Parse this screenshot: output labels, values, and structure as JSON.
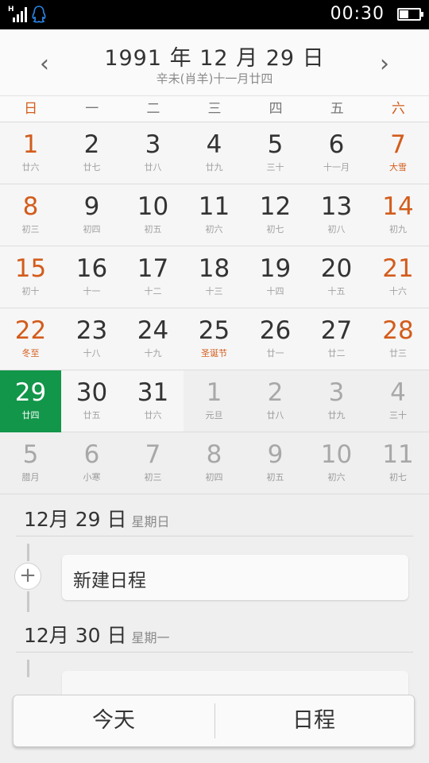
{
  "status_bar": {
    "signal_label": "H",
    "time": "00:30",
    "battery_level": 0.45
  },
  "header": {
    "title": "1991 年 12 月 29 日",
    "lunar_subtitle": "辛未(肖羊)十一月廿四",
    "prev_icon": "chevron-left-icon",
    "next_icon": "chevron-right-icon",
    "prev_glyph": "‹",
    "next_glyph": "›"
  },
  "weekdays": [
    "日",
    "一",
    "二",
    "三",
    "四",
    "五",
    "六"
  ],
  "accent_color": "#d35c1c",
  "selected_color": "#12964a",
  "calendar": {
    "weeks": [
      [
        {
          "day": "1",
          "lunar": "廿六"
        },
        {
          "day": "2",
          "lunar": "廿七"
        },
        {
          "day": "3",
          "lunar": "廿八"
        },
        {
          "day": "4",
          "lunar": "廿九"
        },
        {
          "day": "5",
          "lunar": "三十"
        },
        {
          "day": "6",
          "lunar": "十一月"
        },
        {
          "day": "7",
          "lunar": "大雪",
          "festival": true
        }
      ],
      [
        {
          "day": "8",
          "lunar": "初三"
        },
        {
          "day": "9",
          "lunar": "初四"
        },
        {
          "day": "10",
          "lunar": "初五"
        },
        {
          "day": "11",
          "lunar": "初六"
        },
        {
          "day": "12",
          "lunar": "初七"
        },
        {
          "day": "13",
          "lunar": "初八"
        },
        {
          "day": "14",
          "lunar": "初九"
        }
      ],
      [
        {
          "day": "15",
          "lunar": "初十"
        },
        {
          "day": "16",
          "lunar": "十一"
        },
        {
          "day": "17",
          "lunar": "十二"
        },
        {
          "day": "18",
          "lunar": "十三"
        },
        {
          "day": "19",
          "lunar": "十四"
        },
        {
          "day": "20",
          "lunar": "十五"
        },
        {
          "day": "21",
          "lunar": "十六"
        }
      ],
      [
        {
          "day": "22",
          "lunar": "冬至",
          "festival": true
        },
        {
          "day": "23",
          "lunar": "十八"
        },
        {
          "day": "24",
          "lunar": "十九"
        },
        {
          "day": "25",
          "lunar": "圣诞节",
          "festival": true
        },
        {
          "day": "26",
          "lunar": "廿一"
        },
        {
          "day": "27",
          "lunar": "廿二"
        },
        {
          "day": "28",
          "lunar": "廿三"
        }
      ],
      [
        {
          "day": "29",
          "lunar": "廿四",
          "selected": true
        },
        {
          "day": "30",
          "lunar": "廿五"
        },
        {
          "day": "31",
          "lunar": "廿六"
        },
        {
          "day": "1",
          "lunar": "元旦",
          "other": true
        },
        {
          "day": "2",
          "lunar": "廿八",
          "other": true
        },
        {
          "day": "3",
          "lunar": "廿九",
          "other": true
        },
        {
          "day": "4",
          "lunar": "三十",
          "other": true
        }
      ],
      [
        {
          "day": "5",
          "lunar": "腊月",
          "other": true
        },
        {
          "day": "6",
          "lunar": "小寒",
          "other": true
        },
        {
          "day": "7",
          "lunar": "初三",
          "other": true
        },
        {
          "day": "8",
          "lunar": "初四",
          "other": true
        },
        {
          "day": "9",
          "lunar": "初五",
          "other": true
        },
        {
          "day": "10",
          "lunar": "初六",
          "other": true
        },
        {
          "day": "11",
          "lunar": "初七",
          "other": true
        }
      ]
    ]
  },
  "agenda": {
    "day1": {
      "date": "12月 29 日",
      "weekday": "星期日"
    },
    "new_event_label": "新建日程",
    "add_glyph": "+",
    "day2": {
      "date": "12月 30 日",
      "weekday": "星期一"
    }
  },
  "bottom_bar": {
    "today_label": "今天",
    "schedule_label": "日程"
  }
}
